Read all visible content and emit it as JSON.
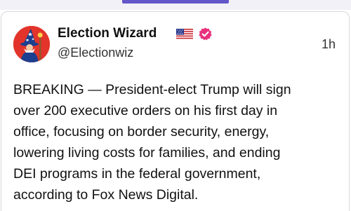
{
  "post": {
    "author": {
      "display_name": "Election Wizard",
      "flag_icon": "us-flag-icon",
      "verified_icon": "verified-badge-icon",
      "verified_color": "#e8317e",
      "handle": "@Electionwiz"
    },
    "timestamp": "1h",
    "body_lines": [
      "BREAKING — President-elect Trump will sign",
      "over 200 executive orders on his first day in",
      "office, focusing on border security, energy,",
      "lowering living costs for families, and ending",
      "DEI programs in the federal government,",
      "according to Fox News Digital."
    ]
  },
  "colors": {
    "accent": "#6256c9",
    "avatar_bg": "#e2342b"
  }
}
